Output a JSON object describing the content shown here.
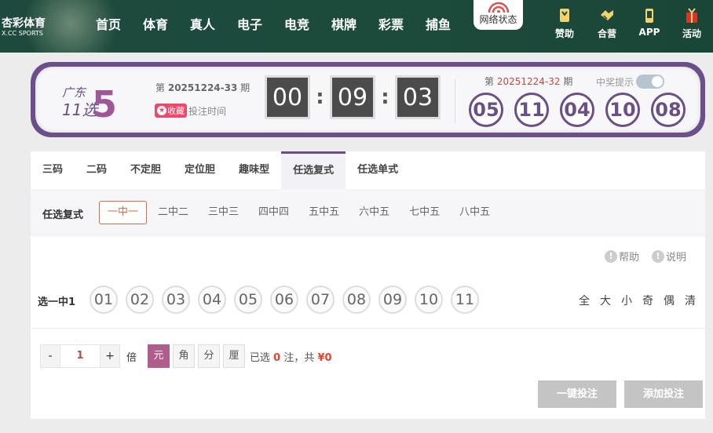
{
  "nav": {
    "logo_cn": "杏彩体育",
    "logo_en": "X.CC SPORTS",
    "links": [
      "首页",
      "体育",
      "真人",
      "电子",
      "电竞",
      "棋牌",
      "彩票",
      "捕鱼"
    ],
    "network_status": "网络状态",
    "right_items": [
      {
        "label": "赞助",
        "icon": "ribbon-icon"
      },
      {
        "label": "合营",
        "icon": "handshake-icon"
      },
      {
        "label": "APP",
        "icon": "phone-icon"
      },
      {
        "label": "活动",
        "icon": "gift-icon"
      }
    ]
  },
  "lottery": {
    "logo_text_top": "广东",
    "logo_text_mid": "11选",
    "logo_number": "5",
    "issue_prefix": "第",
    "issue_no": "20251224-33",
    "issue_suffix": "期",
    "fav_label": "收藏",
    "bet_time_label": "投注时间",
    "timer": [
      "00",
      "09",
      "03"
    ],
    "last_issue_prefix": "第",
    "last_issue_no": "20251224-32",
    "last_issue_suffix": "期",
    "win_hint_label": "中奖提示",
    "last_result": [
      "05",
      "11",
      "04",
      "10",
      "08"
    ]
  },
  "tabs": [
    "三码",
    "二码",
    "不定胆",
    "定位胆",
    "趣味型",
    "任选复式",
    "任选单式"
  ],
  "active_tab": 5,
  "subplay": {
    "label": "任选复式",
    "options": [
      "一中一",
      "二中二",
      "三中三",
      "四中四",
      "五中五",
      "六中五",
      "七中五",
      "八中五"
    ],
    "active": 0
  },
  "help": {
    "help_label": "帮助",
    "explain_label": "说明"
  },
  "pick": {
    "label": "选一中1",
    "numbers": [
      "01",
      "02",
      "03",
      "04",
      "05",
      "06",
      "07",
      "08",
      "09",
      "10",
      "11"
    ],
    "quick": [
      "全",
      "大",
      "小",
      "奇",
      "偶",
      "清"
    ]
  },
  "bet": {
    "minus": "-",
    "multiplier": "1",
    "plus": "+",
    "times_label": "倍",
    "units": [
      "元",
      "角",
      "分",
      "厘"
    ],
    "active_unit": 0,
    "selected_prefix": "已选",
    "selected_count": "0",
    "selected_mid": "注，共",
    "total": "¥0",
    "quick_bet_label": "一键投注",
    "add_bet_label": "添加投注"
  },
  "colors": {
    "brand_purple": "#6a4f8b",
    "nav_green": "#1d4a3c",
    "accent_red": "#e0462c",
    "fav_pink": "#f0486a"
  }
}
